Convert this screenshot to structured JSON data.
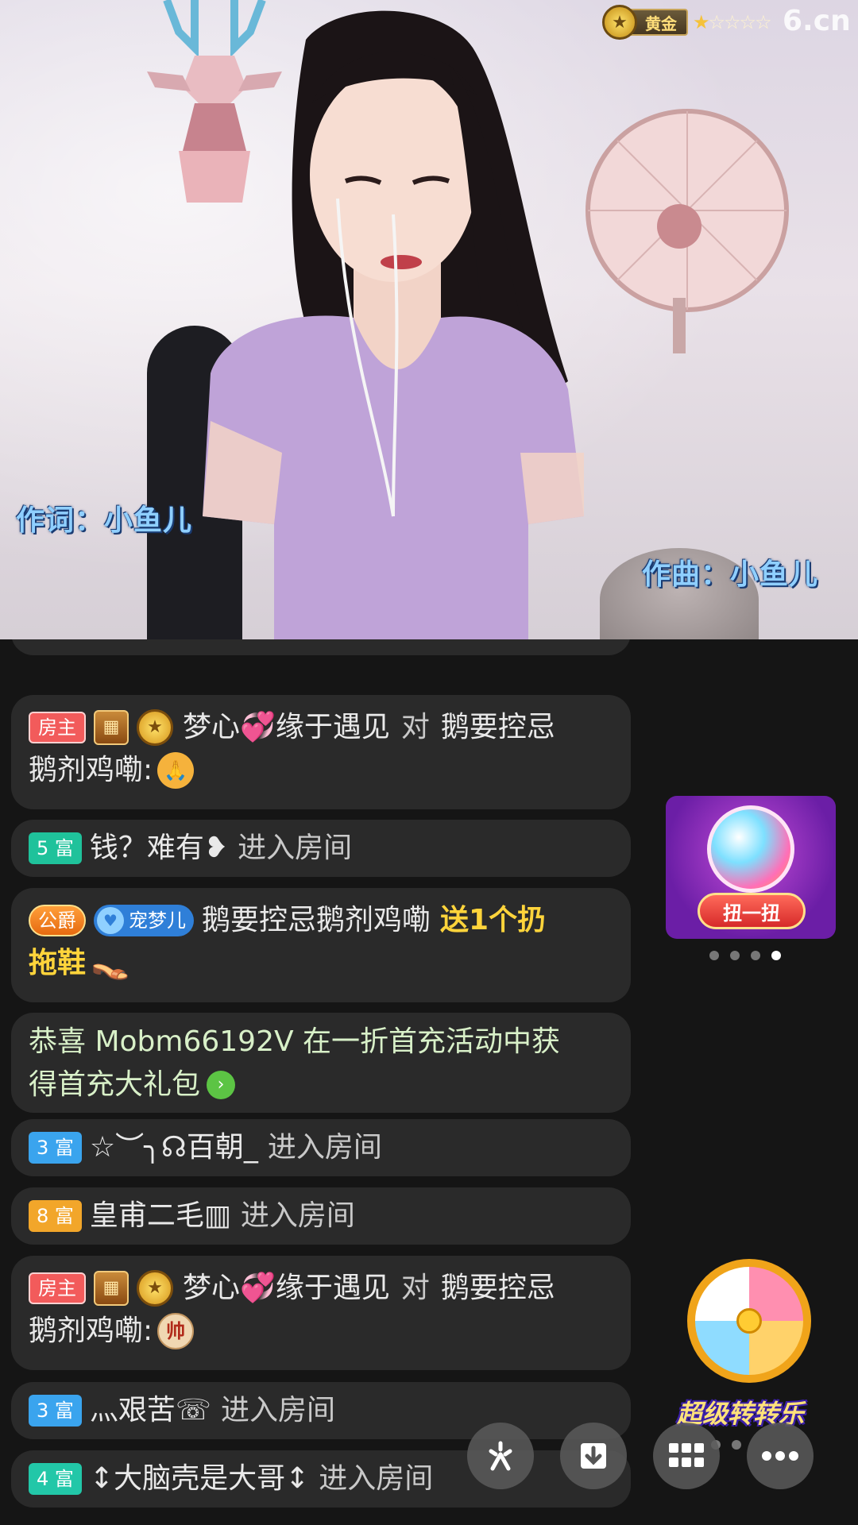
{
  "stream": {
    "lyric_left": "作词：小鱼儿",
    "lyric_right": "作曲：小鱼儿",
    "rank_label": "黄金",
    "rank_stars_filled": 1,
    "rank_stars_total": 5,
    "watermark": "6.cn"
  },
  "chat": {
    "messages": [
      {
        "tag": "房主",
        "user": "梦心💞缘于遇见",
        "mid": "对",
        "target": "鹅要控忌",
        "line2": "鹅剂鸡嘞:",
        "emoji": "🙏"
      },
      {
        "tag": "5 富",
        "user": "钱？难有❥",
        "action": "进入房间"
      },
      {
        "tag": "公爵",
        "pet_tag": "宠梦儿",
        "user": "鹅要控忌鹅剂鸡嘞",
        "gift_line1": "送1个扔",
        "gift_line2": "拖鞋"
      },
      {
        "line1": "恭喜 Mobm66192V 在一折首充活动中获",
        "line2": "得首充大礼包"
      },
      {
        "tag": "3 富",
        "user": "☆︶╮☊百朝_",
        "action": "进入房间"
      },
      {
        "tag": "8 富",
        "user": "皇甫二毛▥",
        "action": "进入房间"
      },
      {
        "tag": "房主",
        "user": "梦心💞缘于遇见",
        "mid": "对",
        "target": "鹅要控忌",
        "line2": "鹅剂鸡嘞:",
        "emoji": "帅"
      },
      {
        "tag": "3 富",
        "user": "灬艰苦☏",
        "action": "进入房间"
      },
      {
        "tag": "4 富",
        "user": "↕大脑壳是大哥↕",
        "action": "进入房间"
      }
    ]
  },
  "promo": {
    "gacha_label": "扭一扭",
    "wheel_label": "超级转转乐"
  },
  "colors": {
    "accent_gold": "#ffd43b",
    "chat_bubble": "#2a2a2a",
    "host_tag": "#f25b5b"
  },
  "icons": {
    "share": "share-icon",
    "download": "download-icon",
    "grid": "grid-icon",
    "more": "more-icon"
  }
}
